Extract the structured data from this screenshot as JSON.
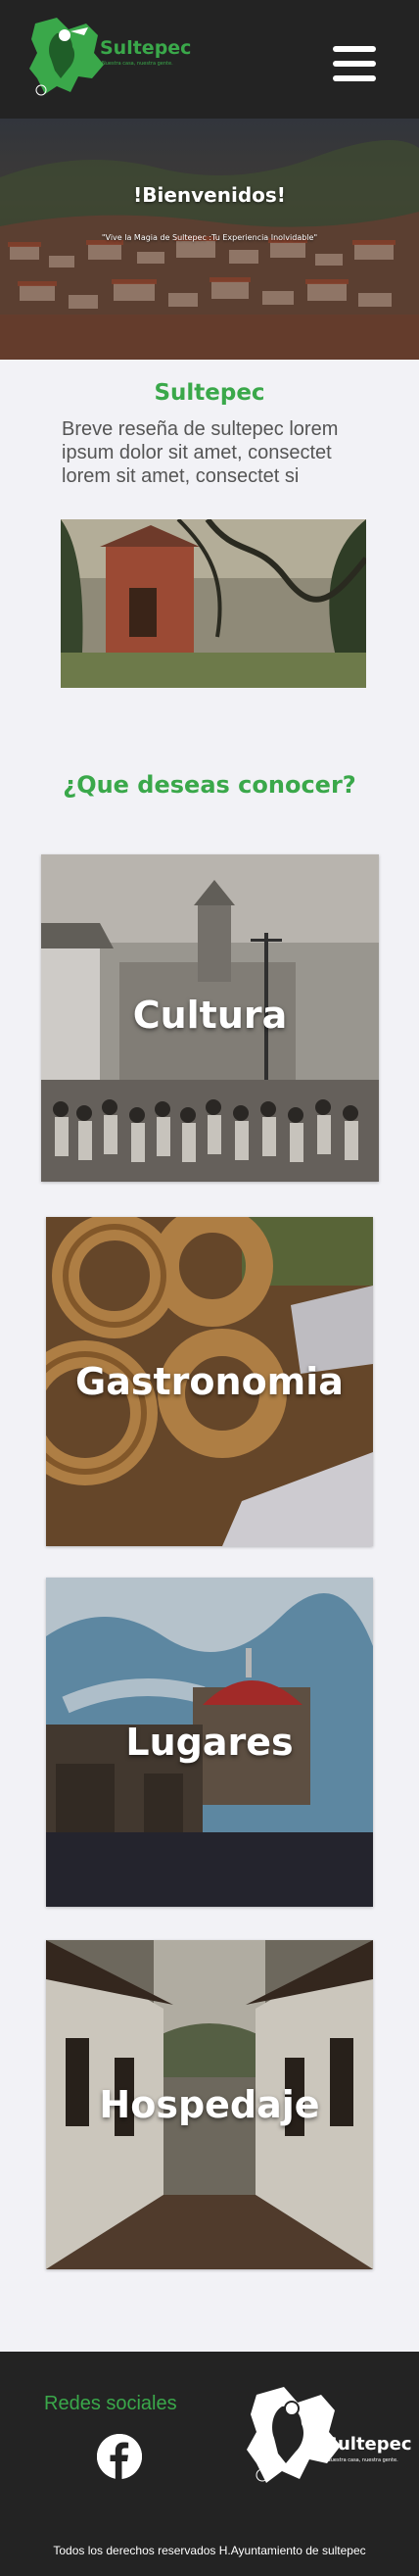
{
  "header": {
    "logo_text": "Sultepec",
    "logo_tagline": "Nuestra casa, nuestra gente.",
    "menu_icon": "hamburger-menu-icon"
  },
  "hero": {
    "title": "!Bienvenidos!",
    "subtitle": "\"Vive la Magia de Sultepec :Tu Experiencia Inolvidable\""
  },
  "about": {
    "title": "Sultepec",
    "text": "Breve reseña de sultepec lorem ipsum dolor sit amet, consectet lorem sit amet, consectet si"
  },
  "explore": {
    "title": "¿Que deseas conocer?",
    "cards": [
      {
        "label": "Cultura"
      },
      {
        "label": "Gastronomia"
      },
      {
        "label": "Lugares"
      },
      {
        "label": "Hospedaje"
      }
    ]
  },
  "footer": {
    "social_label": "Redes sociales",
    "social_icon": "facebook-icon",
    "logo_text": "Sultepec",
    "logo_tagline": "Nuestra casa, nuestra gente.",
    "copyright": "Todos los derechos reservados H.Ayuntamiento de sultepec"
  },
  "colors": {
    "brand_green": "#3aa84a",
    "header_bg": "#232323",
    "page_bg": "#f2f2f6"
  }
}
